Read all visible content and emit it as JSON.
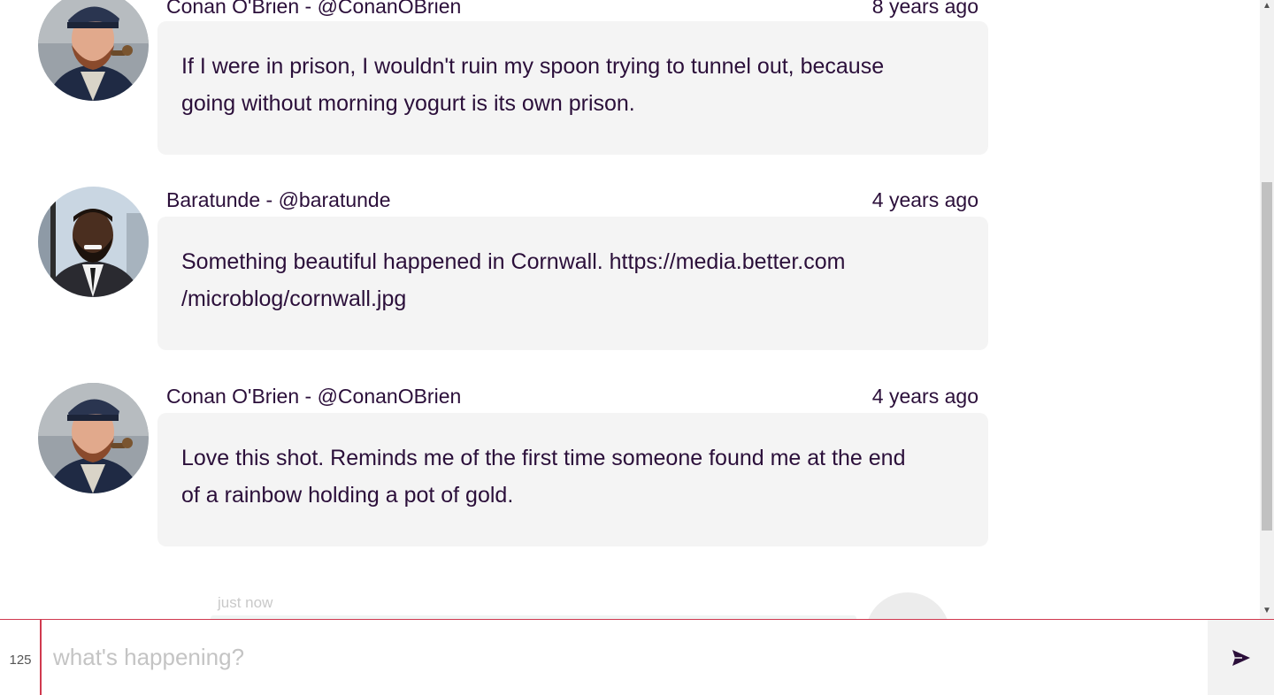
{
  "feed": {
    "posts": [
      {
        "author": "Conan O'Brien - @ConanOBrien",
        "time": "8 years ago",
        "lines": [
          "If I were in prison, I wouldn't ruin my spoon trying to tunnel out, because",
          "going without morning yogurt is its own prison."
        ],
        "avatar": "conan-avatar"
      },
      {
        "author": "Baratunde - @baratunde",
        "time": "4 years ago",
        "lines": [
          "Something beautiful happened in Cornwall. https://media.better.com",
          "/microblog/cornwall.jpg"
        ],
        "avatar": "baratunde-avatar"
      },
      {
        "author": "Conan O'Brien - @ConanOBrien",
        "time": "4 years ago",
        "lines": [
          "Love this shot. Reminds me of the first time someone found me at the end",
          "of a rainbow holding a pot of gold."
        ],
        "avatar": "conan-avatar"
      }
    ],
    "pending": {
      "time": "just now"
    }
  },
  "composer": {
    "char_count": "125",
    "placeholder": "what's happening?",
    "value": "",
    "send_icon": "send-icon"
  },
  "colors": {
    "text": "#2b0f3a",
    "bubble": "#f4f4f4",
    "accent": "#d0394f",
    "placeholder": "#c4c4c4"
  }
}
